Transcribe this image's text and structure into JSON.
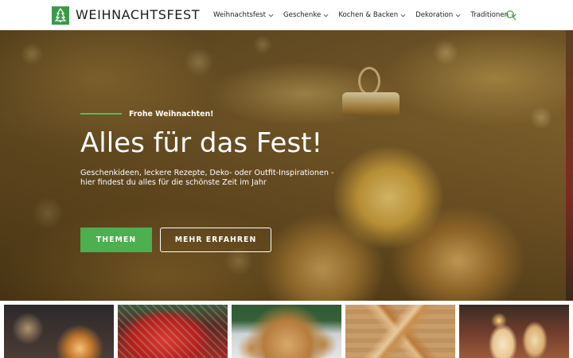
{
  "brand": {
    "name": "WEIHNACHTSFEST",
    "accent_color": "#4caf50",
    "logo_icon": "christmas-tree-icon"
  },
  "nav": {
    "items": [
      {
        "label": "Weihnachtsfest",
        "icon": "chevron-down-icon"
      },
      {
        "label": "Geschenke",
        "icon": "chevron-down-icon"
      },
      {
        "label": "Kochen & Backen",
        "icon": "chevron-down-icon"
      },
      {
        "label": "Dekoration",
        "icon": "chevron-down-icon"
      },
      {
        "label": "Traditionen",
        "icon": "chevron-down-icon"
      }
    ],
    "search_icon": "search-icon"
  },
  "hero": {
    "eyebrow": "Frohe Weihnachten!",
    "title": "Alles für das Fest!",
    "description": "Geschenkideen, leckere Rezepte, Deko- oder Outfit-Inspirationen - hier findest du alles für die schönste Zeit im Jahr",
    "primary_button": "THEMEN",
    "secondary_button": "MEHR ERFAHREN"
  }
}
